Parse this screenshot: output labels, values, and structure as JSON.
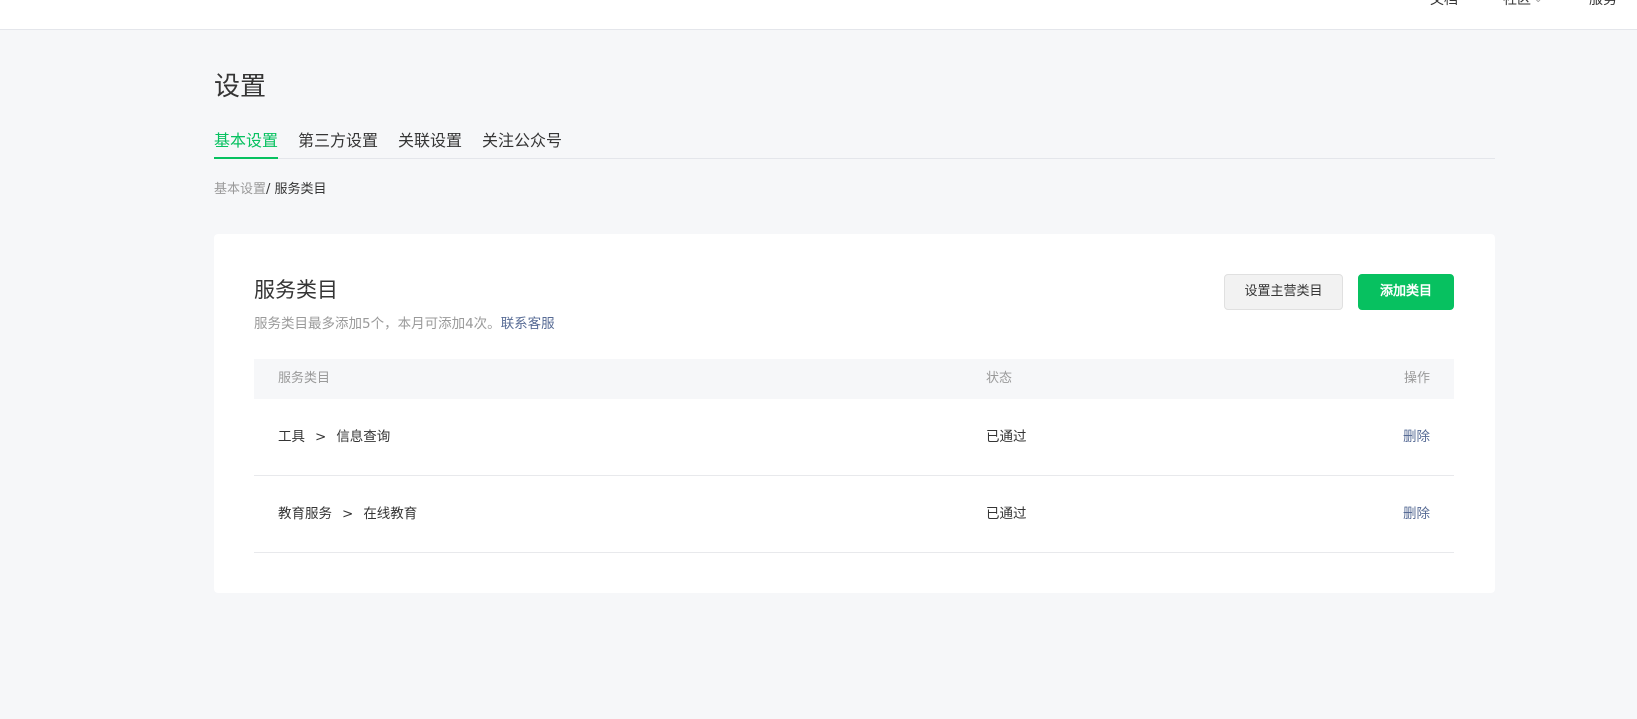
{
  "topnav": {
    "docs": "文档",
    "community": "社区",
    "service": "服务"
  },
  "page_title": "设置",
  "tabs": [
    {
      "label": "基本设置",
      "active": true
    },
    {
      "label": "第三方设置",
      "active": false
    },
    {
      "label": "关联设置",
      "active": false
    },
    {
      "label": "关注公众号",
      "active": false
    }
  ],
  "breadcrumb": {
    "parent": "基本设置",
    "separator": "/ ",
    "current": "服务类目"
  },
  "card": {
    "title": "服务类目",
    "desc": "服务类目最多添加5个，本月可添加4次。",
    "desc_link": "联系客服",
    "btn_set_main": "设置主营类目",
    "btn_add": "添加类目"
  },
  "table": {
    "headers": {
      "category": "服务类目",
      "status": "状态",
      "op": "操作"
    },
    "rows": [
      {
        "cat1": "工具",
        "sep": ">",
        "cat2": "信息查询",
        "status": "已通过",
        "op": "删除"
      },
      {
        "cat1": "教育服务",
        "sep": ">",
        "cat2": "在线教育",
        "status": "已通过",
        "op": "删除"
      }
    ]
  },
  "colors": {
    "accent": "#07c160",
    "link": "#576b95",
    "background": "#f6f7f9"
  }
}
